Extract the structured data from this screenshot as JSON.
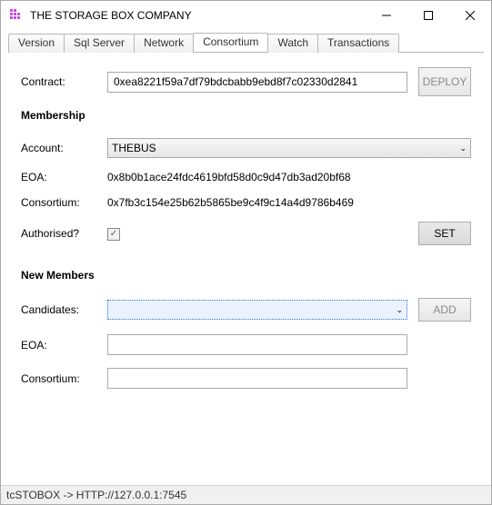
{
  "window": {
    "title": "THE STORAGE BOX COMPANY"
  },
  "tabs": [
    "Version",
    "Sql Server",
    "Network",
    "Consortium",
    "Watch",
    "Transactions"
  ],
  "contract": {
    "label": "Contract:",
    "value": "0xea8221f59a7df79bdcbabb9ebd8f7c02330d2841",
    "deploy_label": "DEPLOY"
  },
  "membership": {
    "title": "Membership",
    "account_label": "Account:",
    "account_value": "THEBUS",
    "eoa_label": "EOA:",
    "eoa_value": "0x8b0b1ace24fdc4619bfd58d0c9d47db3ad20bf68",
    "consortium_label": "Consortium:",
    "consortium_value": "0x7fb3c154e25b62b5865be9c4f9c14a4d9786b469",
    "authorised_label": "Authorised?",
    "set_label": "SET"
  },
  "newmembers": {
    "title": "New Members",
    "candidates_label": "Candidates:",
    "candidates_value": "",
    "eoa_label": "EOA:",
    "eoa_value": "",
    "consortium_label": "Consortium:",
    "consortium_value": "",
    "add_label": "ADD"
  },
  "statusbar": "tcSTOBOX -> HTTP://127.0.0.1:7545"
}
